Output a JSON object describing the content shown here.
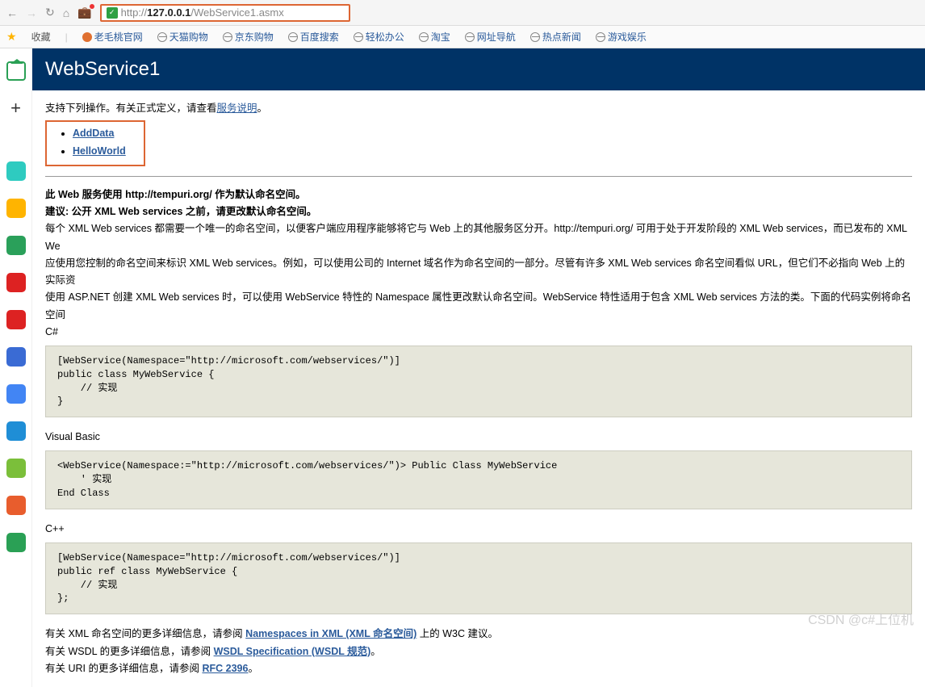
{
  "browser": {
    "url_prefix": "http://",
    "url_bold": "127.0.0.1",
    "url_suffix": "/WebService1.asmx"
  },
  "bookmarks": {
    "fav_label": "收藏",
    "items": [
      "老毛桃官网",
      "天猫购物",
      "京东购物",
      "百度搜索",
      "轻松办公",
      "淘宝",
      "网址导航",
      "热点新闻",
      "游戏娱乐"
    ]
  },
  "sidebar": {
    "colors": [
      "#2ecbc0",
      "#ffb400",
      "#2aa05a",
      "#d22",
      "#d22",
      "#3a6bd4",
      "#4285f4",
      "#1f8ed6",
      "#7bbf3a",
      "#e85d2d",
      "#2aa055"
    ],
    "home_stroke": "#2aa055",
    "plus_stroke": "#333"
  },
  "page": {
    "title": "WebService1",
    "intro_prefix": "支持下列操作。有关正式定义，请查看",
    "service_desc": "服务说明",
    "intro_suffix": "。",
    "ops": [
      "AddData",
      "HelloWorld"
    ],
    "ns_line": "此 Web 服务使用 http://tempuri.org/ 作为默认命名空间。",
    "advice": "建议: 公开 XML Web services 之前，请更改默认命名空间。",
    "para1": "每个 XML Web services 都需要一个唯一的命名空间，以便客户端应用程序能够将它与 Web 上的其他服务区分开。http://tempuri.org/ 可用于处于开发阶段的 XML Web services，而已发布的 XML We",
    "para2": "应使用您控制的命名空间来标识 XML Web services。例如，可以使用公司的 Internet 域名作为命名空间的一部分。尽管有许多 XML Web services 命名空间看似 URL，但它们不必指向 Web 上的实际资",
    "para3": "使用 ASP.NET 创建 XML Web services 时，可以使用 WebService 特性的 Namespace 属性更改默认命名空间。WebService 特性适用于包含 XML Web services 方法的类。下面的代码实例将命名空间",
    "lang_cs": "C#",
    "code_cs": "[WebService(Namespace=\"http://microsoft.com/webservices/\")]\npublic class MyWebService {\n    // 实现\n}",
    "lang_vb": "Visual Basic",
    "code_vb": "<WebService(Namespace:=\"http://microsoft.com/webservices/\")> Public Class MyWebService\n    ' 实现\nEnd Class",
    "lang_cpp": "C++",
    "code_cpp": "[WebService(Namespace=\"http://microsoft.com/webservices/\")]\npublic ref class MyWebService {\n    // 实现\n};",
    "ref1_pre": "有关 XML 命名空间的更多详细信息，请参阅 ",
    "ref1_link": "Namespaces in XML (XML 命名空间)",
    "ref1_post": " 上的 W3C 建议。",
    "ref2_pre": "有关 WSDL 的更多详细信息，请参阅 ",
    "ref2_link": "WSDL Specification (WSDL 规范)",
    "ref2_post": "。",
    "ref3_pre": "有关 URI 的更多详细信息，请参阅 ",
    "ref3_link": "RFC 2396",
    "ref3_post": "。"
  },
  "watermark": "CSDN @c#上位机"
}
